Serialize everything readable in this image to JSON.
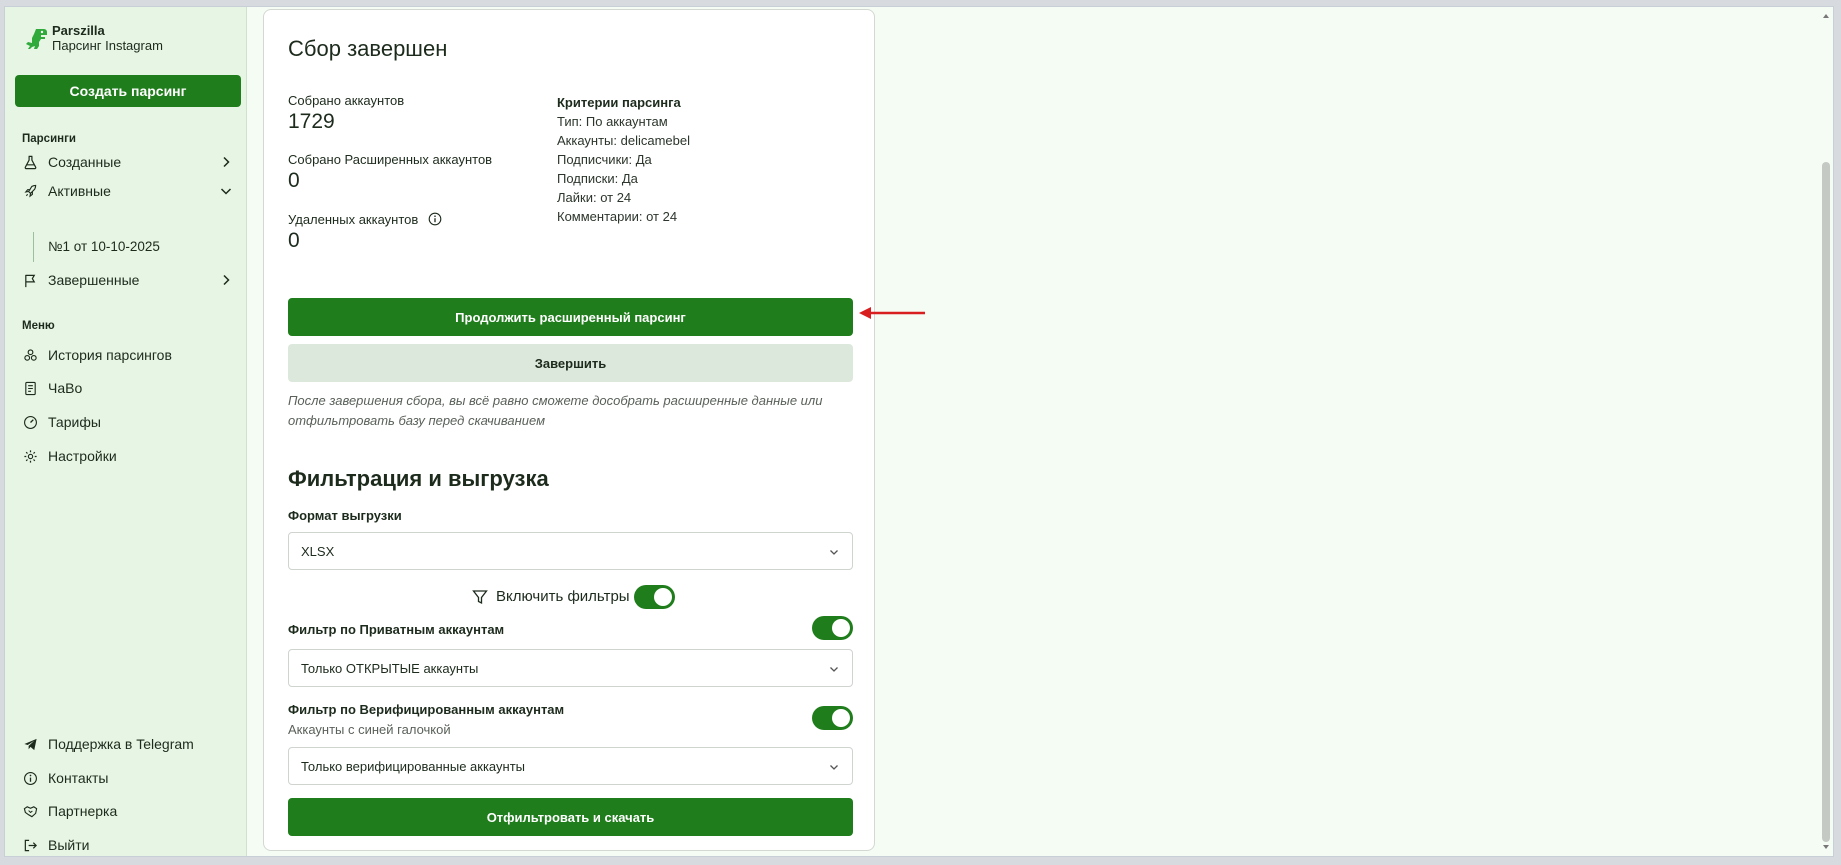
{
  "brand": {
    "name": "Parszilla",
    "subtitle": "Парсинг Instagram"
  },
  "sidebar": {
    "create_button": "Создать парсинг",
    "section_parsings": "Парсинги",
    "nav_created": "Созданные",
    "nav_active": "Активные",
    "nav_active_sub": "№1 от 10-10-2025",
    "nav_finished": "Завершенные",
    "section_menu": "Меню",
    "menu_history": "История парсингов",
    "menu_faq": "ЧаВо",
    "menu_tariffs": "Тарифы",
    "menu_settings": "Настройки",
    "bottom_support": "Поддержка в Telegram",
    "bottom_contacts": "Контакты",
    "bottom_partner": "Партнерка",
    "bottom_logout": "Выйти"
  },
  "main": {
    "title": "Сбор завершен",
    "stats": {
      "collected_label": "Собрано аккаунтов",
      "collected_value": "1729",
      "extended_label": "Собрано Расширенных аккаунтов",
      "extended_value": "0",
      "deleted_label": "Удаленных аккаунтов",
      "deleted_value": "0"
    },
    "criteria": {
      "heading": "Критерии парсинга",
      "type": "Тип: По аккаунтам",
      "accounts": "Аккаунты: delicamebel",
      "followers": "Подписчики: Да",
      "following": "Подписки: Да",
      "likes": "Лайки: от 24",
      "comments": "Комментарии: от 24"
    },
    "continue_button": "Продолжить расширенный парсинг",
    "finish_button": "Завершить",
    "hint": "После завершения сбора, вы всё равно сможете дособрать расширенные данные или отфильтровать базу перед скачиванием",
    "filter_section_title": "Фильтрация и выгрузка",
    "format_label": "Формат выгрузки",
    "format_value": "XLSX",
    "enable_filters_label": "Включить фильтры",
    "enable_filters_on": true,
    "private_filter_label": "Фильтр по Приватным аккаунтам",
    "private_filter_value": "Только ОТКРЫТЫЕ аккаунты",
    "private_filter_on": true,
    "verified_filter_label": "Фильтр по Верифицированным аккаунтам",
    "verified_filter_sub": "Аккаунты с синей галочкой",
    "verified_filter_value": "Только верифицированные аккаунты",
    "verified_filter_on": true,
    "download_button": "Отфильтровать и скачать"
  },
  "colors": {
    "accent": "#1f7d1c",
    "sidebar_bg": "#e6f5e4",
    "light_button": "#dde8dc",
    "annotation_arrow": "#d81e1e"
  }
}
